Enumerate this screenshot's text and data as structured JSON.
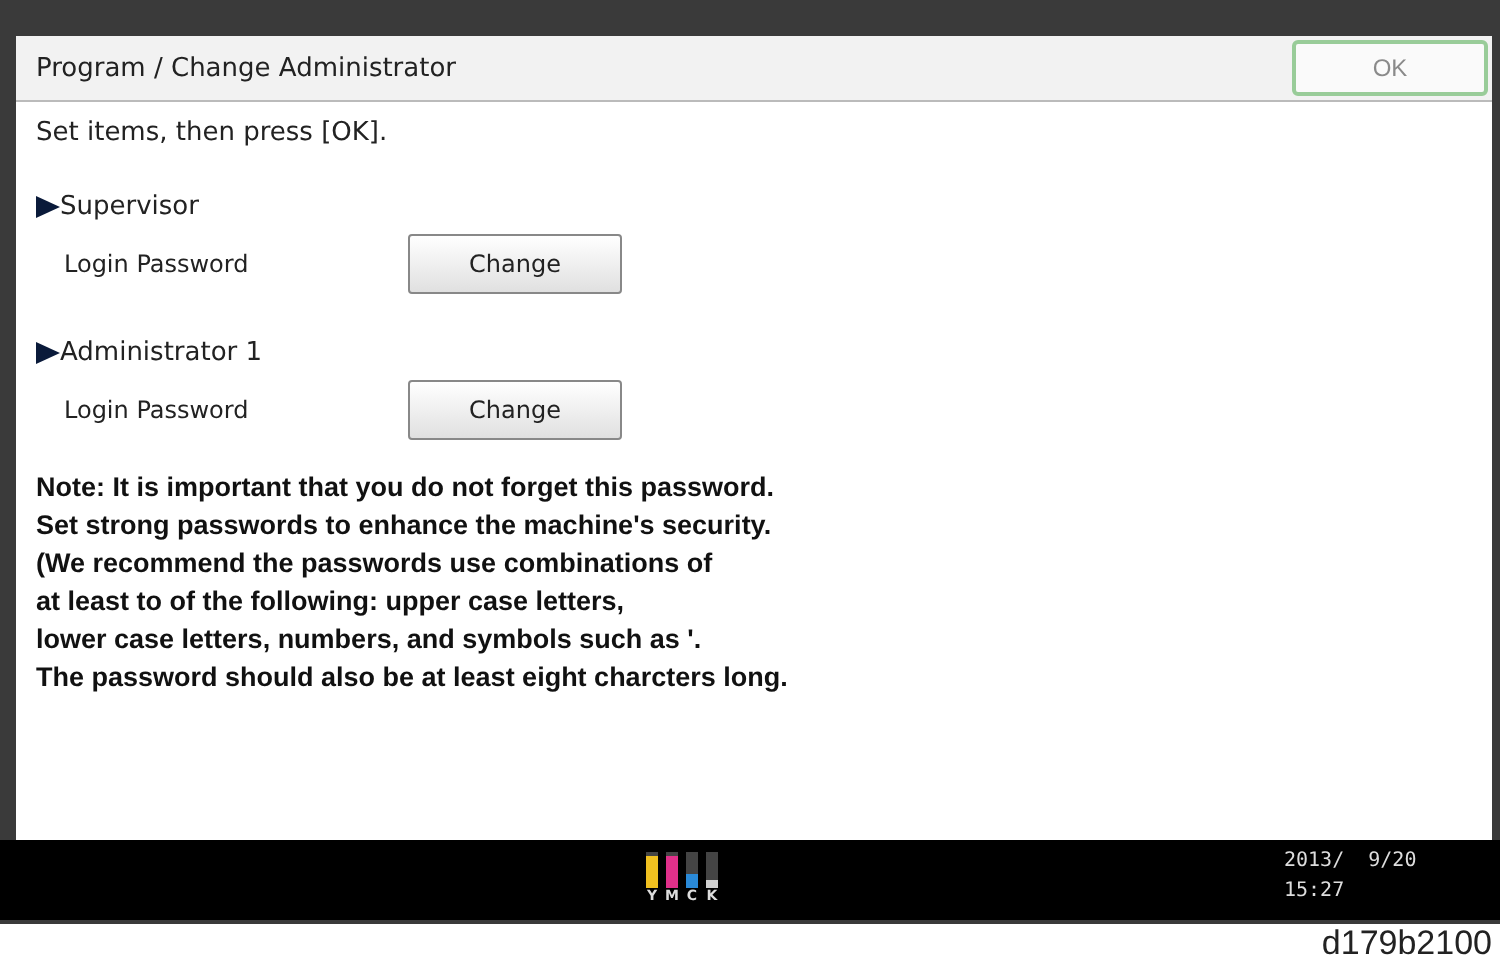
{
  "window": {
    "title": "Program / Change Administrator"
  },
  "ok_button": {
    "label": "OK",
    "disabled": true
  },
  "instruction": "Set items, then press [OK].",
  "sections": [
    {
      "title": "Supervisor",
      "field_label": "Login Password",
      "button": "Change"
    },
    {
      "title": "Administrator 1",
      "field_label": "Login Password",
      "button": "Change"
    }
  ],
  "note_lines": [
    "Note: It is important that you do not forget this password.",
    "Set strong passwords to enhance the machine's security.",
    "(We recommend the passwords use combinations of",
    "at least to of the following:  upper case letters,",
    "lower case letters, numbers, and symbols such as '.",
    "The password should also be at least eight charcters long."
  ],
  "status_bar": {
    "toner": [
      {
        "label": "Y",
        "color": "#f0c020",
        "level": 0.9
      },
      {
        "label": "M",
        "color": "#e0308a",
        "level": 0.9
      },
      {
        "label": "C",
        "color": "#2a8ad8",
        "level": 0.4
      },
      {
        "label": "K",
        "color": "#d0d0d0",
        "level": 0.2
      }
    ],
    "date": "2013/  9/20",
    "time": "15:27"
  },
  "caption": "d179b2100"
}
